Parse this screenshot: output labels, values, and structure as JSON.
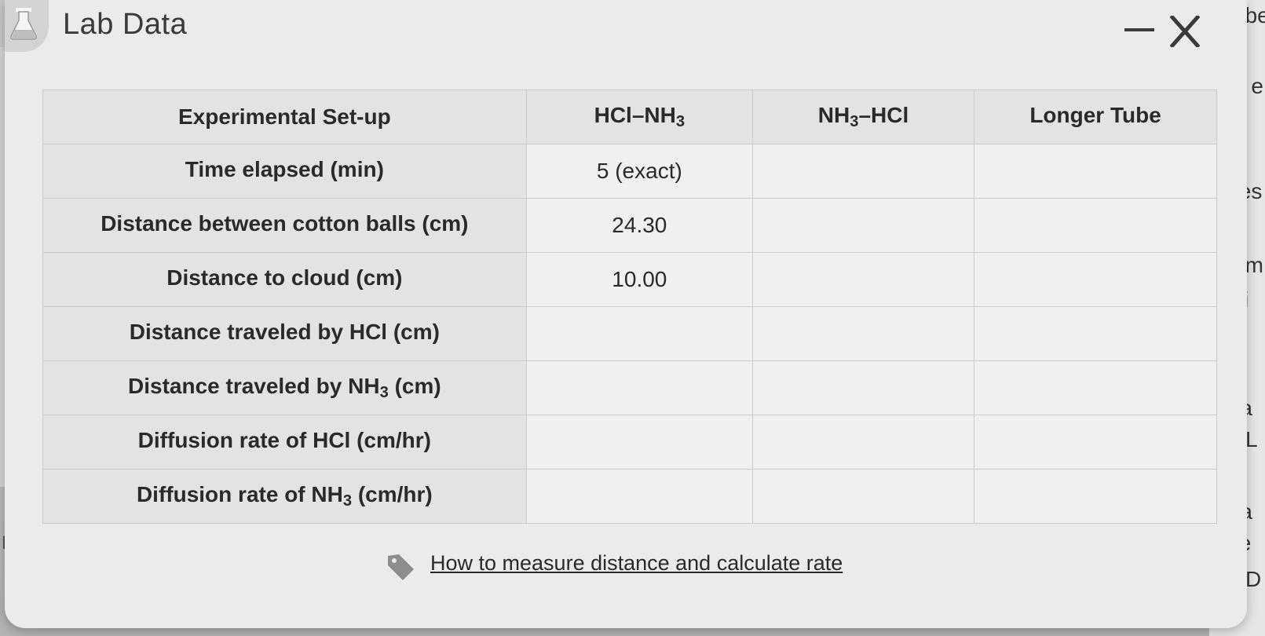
{
  "window": {
    "title": "Lab Data",
    "minimize_symbol": "—",
    "close_symbol": "X",
    "icon": "flask-icon"
  },
  "table": {
    "header": {
      "label": "Experimental Set-up",
      "columns": [
        {
          "parts": [
            "HCl–NH",
            "3",
            ""
          ]
        },
        {
          "parts": [
            "NH",
            "3",
            "–HCl"
          ]
        },
        {
          "parts": [
            "Longer Tube",
            "",
            ""
          ]
        }
      ]
    },
    "rows": [
      {
        "parts": [
          "Time elapsed (min)",
          "",
          ""
        ],
        "values": [
          "5 (exact)",
          "",
          ""
        ]
      },
      {
        "parts": [
          "Distance between cotton balls (cm)",
          "",
          ""
        ],
        "values": [
          "24.30",
          "",
          ""
        ]
      },
      {
        "parts": [
          "Distance to cloud (cm)",
          "",
          ""
        ],
        "values": [
          "10.00",
          "",
          ""
        ]
      },
      {
        "parts": [
          "Distance traveled by HCl (cm)",
          "",
          ""
        ],
        "values": [
          "",
          "",
          ""
        ]
      },
      {
        "parts": [
          "Distance traveled by NH",
          "3",
          " (cm)"
        ],
        "values": [
          "",
          "",
          ""
        ]
      },
      {
        "parts": [
          "Diffusion rate of HCl (cm/hr)",
          "",
          ""
        ],
        "values": [
          "",
          "",
          ""
        ]
      },
      {
        "parts": [
          "Diffusion rate of NH",
          "3",
          " (cm/hr)"
        ],
        "values": [
          "",
          "",
          ""
        ]
      }
    ]
  },
  "help": {
    "icon": "tag-icon",
    "link_text": "How to measure distance and calculate rate"
  },
  "background_fragments": [
    "ube",
    "h e",
    "tes",
    "am",
    "iti",
    "ra",
    "L",
    "ra",
    "te",
    "D",
    "M"
  ]
}
